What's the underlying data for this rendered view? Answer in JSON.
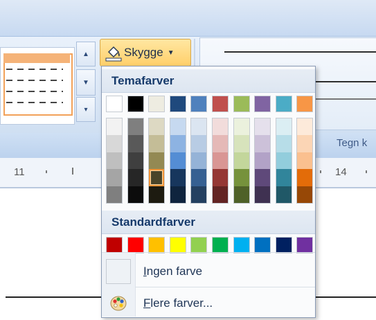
{
  "toolbar": {
    "shading_label": "Skygge",
    "group_label": "Tegn k"
  },
  "ruler": {
    "numbers": [
      "11",
      "14"
    ]
  },
  "shading_menu": {
    "theme_header": "Temafarver",
    "standard_header": "Standardfarver",
    "theme_colors": [
      "#ffffff",
      "#000000",
      "#eeece1",
      "#1f497d",
      "#4f81bd",
      "#c0504d",
      "#9bbb59",
      "#8064a2",
      "#4bacc6",
      "#f79646"
    ],
    "theme_tints": [
      [
        "#f2f2f2",
        "#d8d8d8",
        "#bfbfbf",
        "#a5a5a5",
        "#7f7f7f"
      ],
      [
        "#7f7f7f",
        "#595959",
        "#3f3f3f",
        "#262626",
        "#0c0c0c"
      ],
      [
        "#ddd9c3",
        "#c4bd97",
        "#938953",
        "#494429",
        "#1d1b10"
      ],
      [
        "#c6d9f0",
        "#8db3e2",
        "#548dd4",
        "#17365d",
        "#0f243e"
      ],
      [
        "#dbe5f1",
        "#b8cce4",
        "#95b3d7",
        "#366092",
        "#244061"
      ],
      [
        "#f2dcdb",
        "#e5b9b7",
        "#d99694",
        "#953734",
        "#632423"
      ],
      [
        "#ebf1dd",
        "#d7e3bc",
        "#c3d69b",
        "#76923c",
        "#4f6128"
      ],
      [
        "#e5e0ec",
        "#ccc1d9",
        "#b2a2c7",
        "#5f497a",
        "#3f3151"
      ],
      [
        "#dbeef3",
        "#b7dde8",
        "#92cddc",
        "#31859b",
        "#205867"
      ],
      [
        "#fdeada",
        "#fbd5b5",
        "#fac08f",
        "#e36c09",
        "#974806"
      ]
    ],
    "selected_tint": {
      "column": 2,
      "row": 3
    },
    "standard_colors": [
      "#c00000",
      "#ff0000",
      "#ffc000",
      "#ffff00",
      "#92d050",
      "#00b050",
      "#00b0f0",
      "#0070c0",
      "#002060",
      "#7030a0"
    ],
    "no_color": {
      "accel": "I",
      "rest": "ngen farve"
    },
    "more_colors": {
      "accel": "F",
      "rest": "lere farver..."
    }
  }
}
